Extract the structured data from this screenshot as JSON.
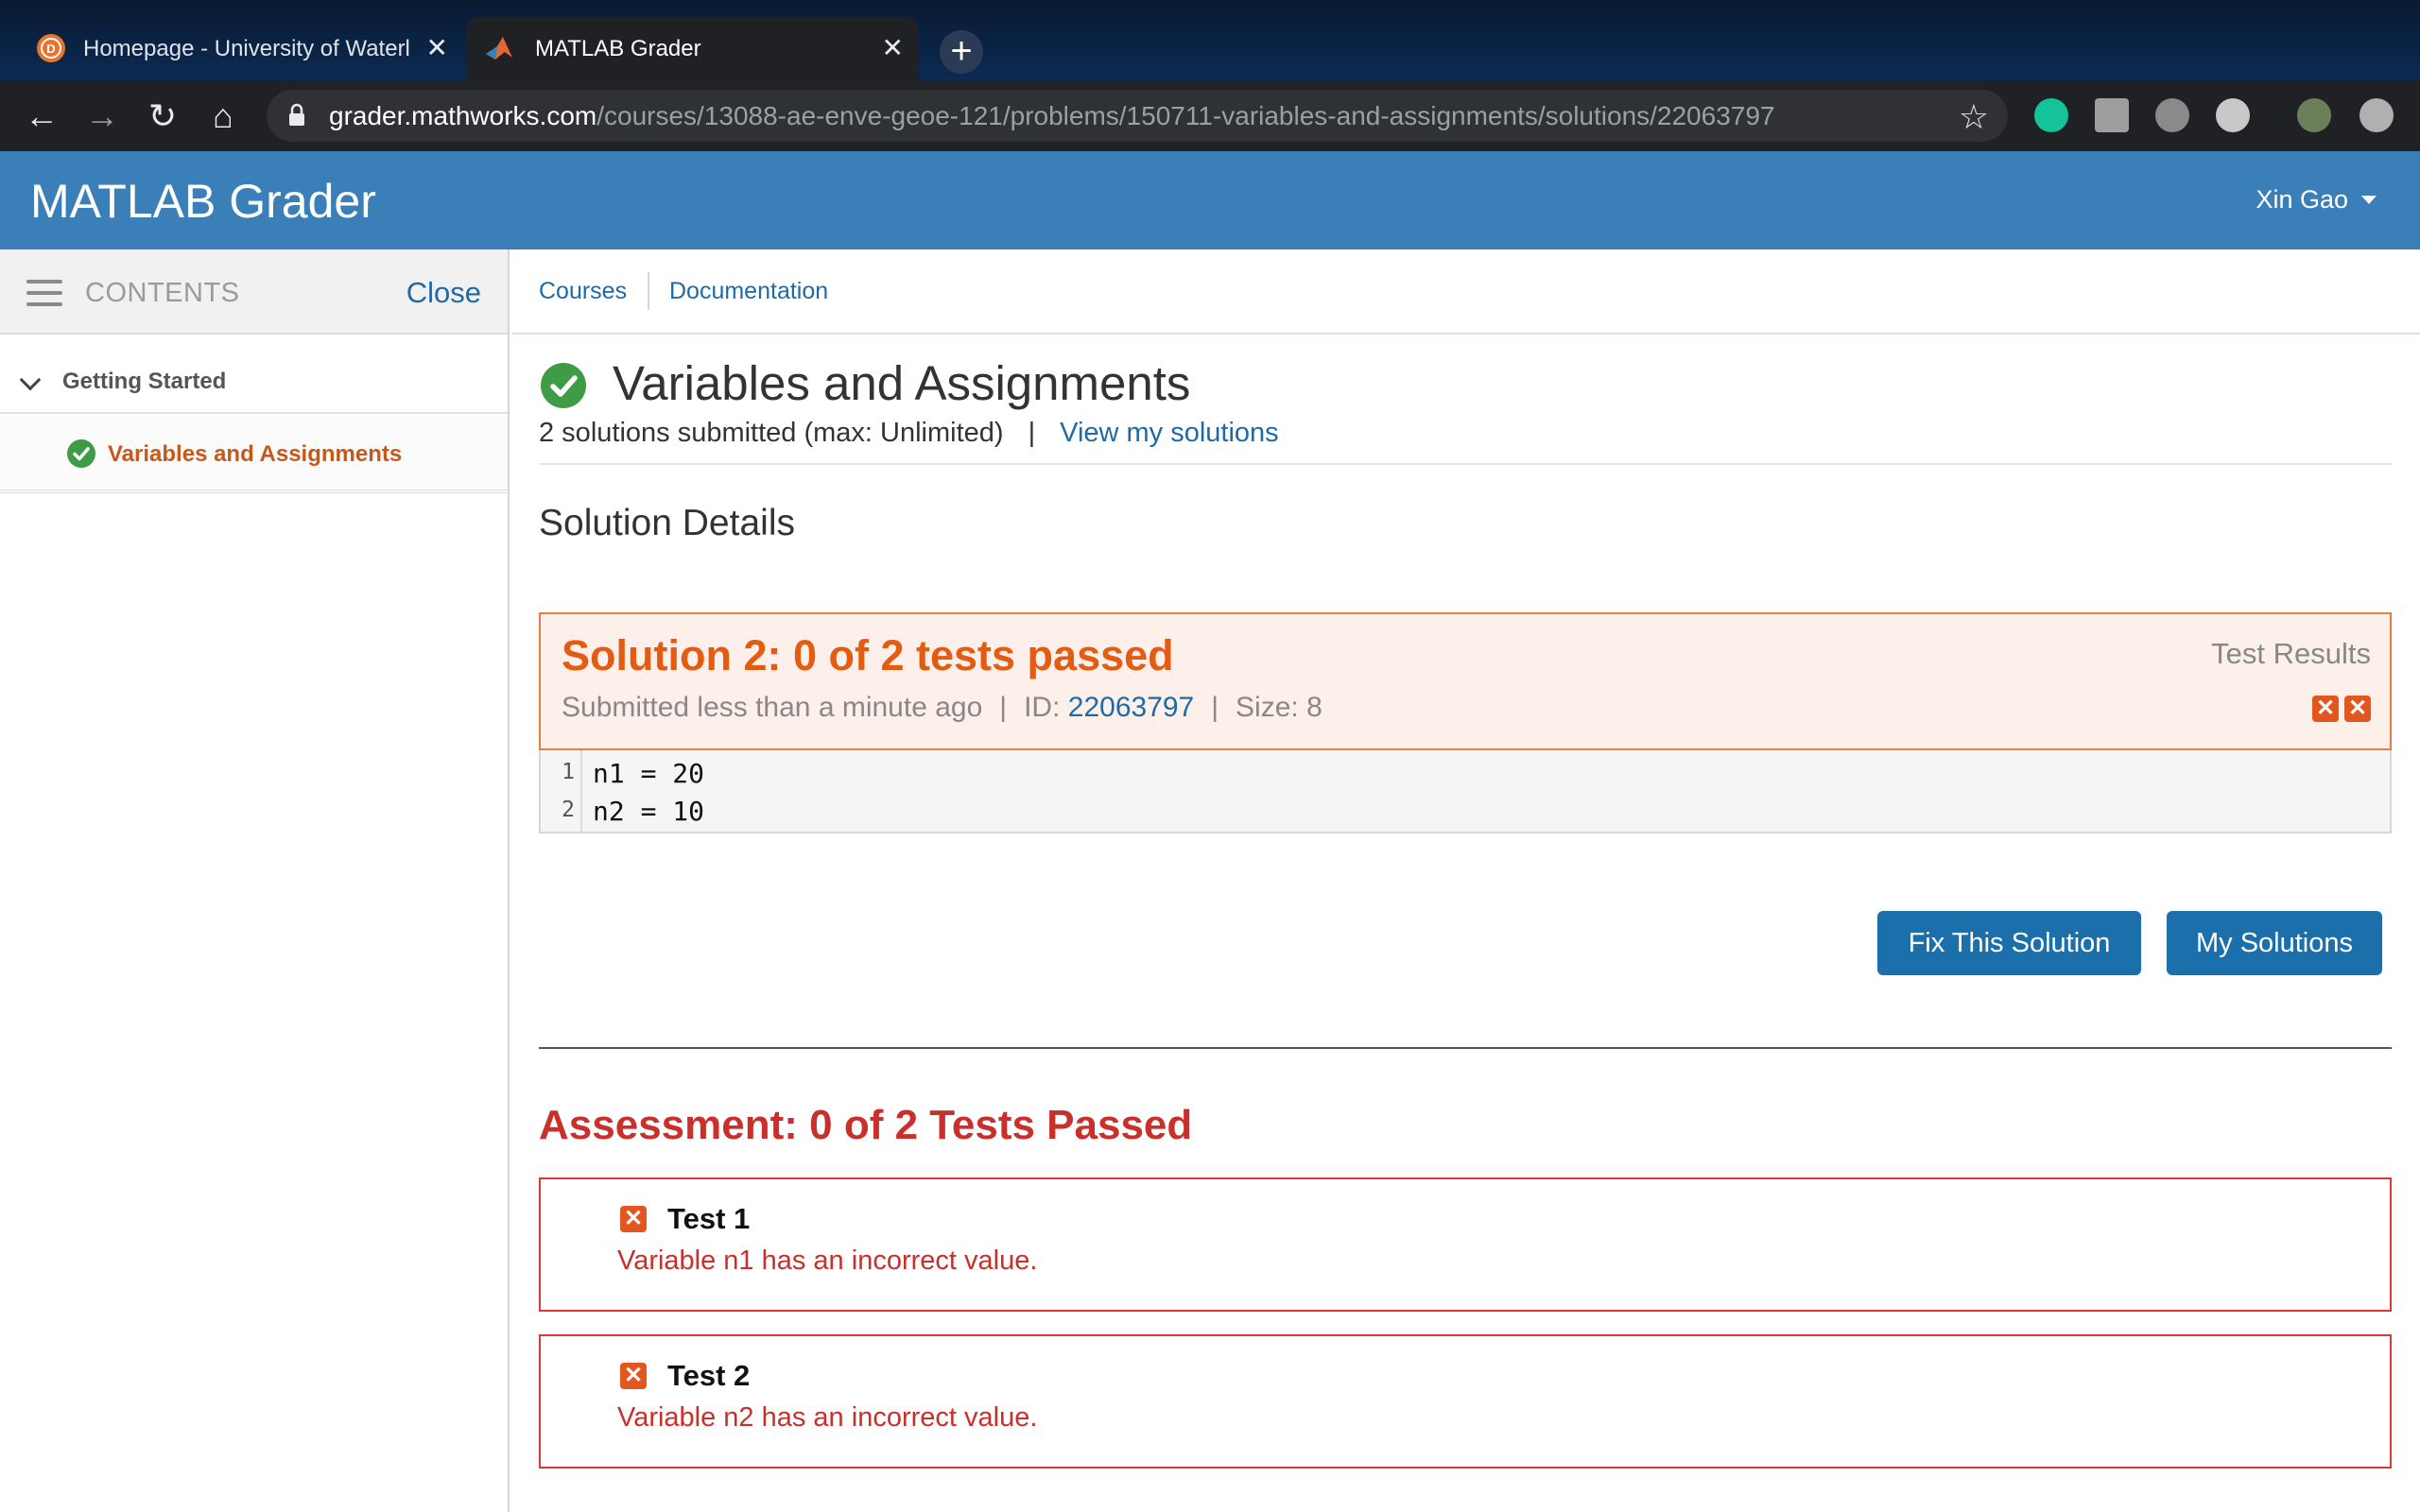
{
  "browser": {
    "tabs": [
      {
        "title": "Homepage - University of Waterl",
        "active": false,
        "close": "✕"
      },
      {
        "title": "MATLAB Grader",
        "active": true,
        "close": "✕"
      }
    ],
    "new_tab": "+",
    "url_host": "grader.mathworks.com",
    "url_path": "/courses/13088-ae-enve-geoe-121/problems/150711-variables-and-assignments/solutions/22063797",
    "nav": {
      "back": "←",
      "forward": "→",
      "reload": "↻",
      "home": "⌂",
      "star": "☆"
    }
  },
  "app": {
    "title": "MATLAB Grader",
    "user": "Xin Gao",
    "brand_color": "#3b7fb8"
  },
  "sidebar": {
    "contents_label": "CONTENTS",
    "close_label": "Close",
    "group": "Getting Started",
    "items": [
      {
        "label": "Variables and Assignments",
        "status": "passed"
      }
    ]
  },
  "subnav": {
    "courses": "Courses",
    "documentation": "Documentation"
  },
  "problem": {
    "title": "Variables and Assignments",
    "submitted": "2 solutions submitted (max: Unlimited)",
    "pipe": "|",
    "view_solutions": "View my solutions"
  },
  "solution_details": {
    "heading": "Solution Details",
    "title": "Solution 2: 0 of 2 tests passed",
    "submitted": "Submitted less than a minute ago",
    "id_label": "ID:",
    "id": "22063797",
    "size": "Size: 8",
    "sep": "|",
    "test_results_label": "Test Results",
    "result_icons": [
      "✕",
      "✕"
    ],
    "code": [
      {
        "line": "1",
        "text": "n1 = 20"
      },
      {
        "line": "2",
        "text": "n2 = 10"
      }
    ],
    "fix_button": "Fix This Solution",
    "my_solutions_button": "My Solutions"
  },
  "assessment": {
    "title": "Assessment: 0 of 2 Tests Passed",
    "tests": [
      {
        "name": "Test 1",
        "message": "Variable n1 has an incorrect value.",
        "icon": "✕"
      },
      {
        "name": "Test 2",
        "message": "Variable n2 has an incorrect value.",
        "icon": "✕"
      }
    ]
  },
  "colors": {
    "fail_orange": "#e35c12",
    "fail_red": "#c9302c",
    "link_blue": "#1f6aa5",
    "pass_green": "#3e9c47"
  }
}
